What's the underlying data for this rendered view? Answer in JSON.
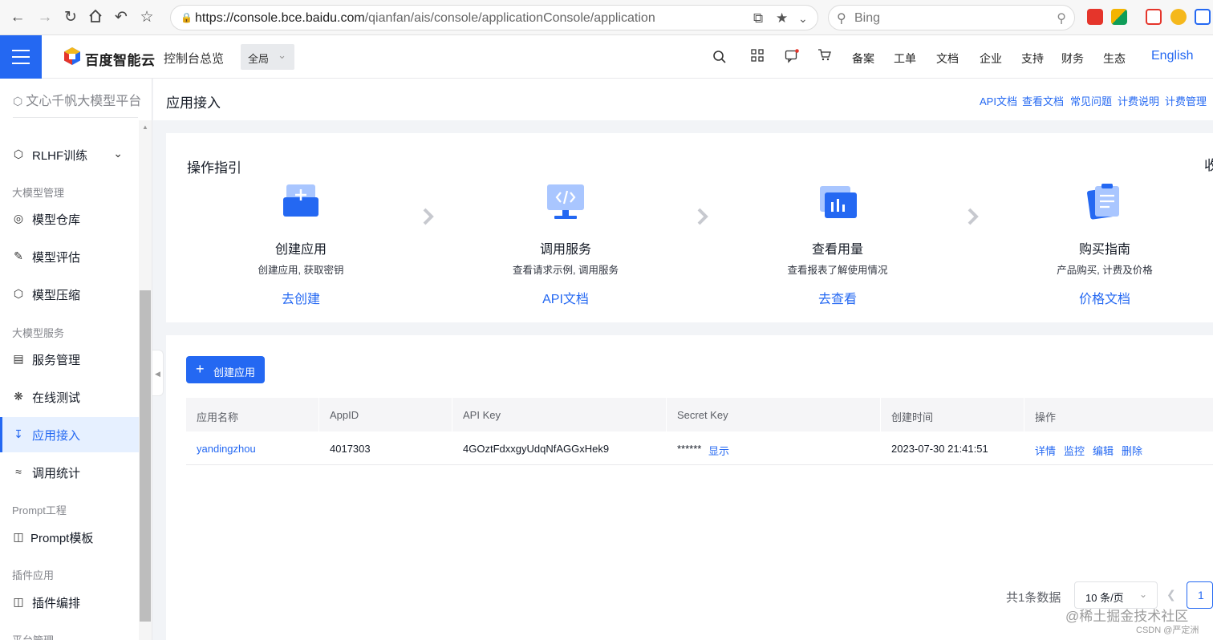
{
  "browser": {
    "url_host": "https://console.bce.baidu.com",
    "url_path": "/qianfan/ais/console/applicationConsole/application",
    "search_placeholder": "Bing"
  },
  "header": {
    "logo_text": "百度智能云",
    "console_home": "控制台总览",
    "region": "全局",
    "links": [
      "备案",
      "工单",
      "文档",
      "企业",
      "支持",
      "财务",
      "生态"
    ],
    "language": "English"
  },
  "sidebar": {
    "title": "文心千帆大模型平台",
    "items": [
      {
        "label": "RLHF训练"
      },
      {
        "label": "大模型管理"
      },
      {
        "label": "模型仓库"
      },
      {
        "label": "模型评估"
      },
      {
        "label": "模型压缩"
      },
      {
        "label": "大模型服务"
      },
      {
        "label": "服务管理"
      },
      {
        "label": "在线测试"
      },
      {
        "label": "应用接入"
      },
      {
        "label": "调用统计"
      },
      {
        "label": "Prompt工程"
      },
      {
        "label": "Prompt模板"
      },
      {
        "label": "插件应用"
      },
      {
        "label": "插件编排"
      },
      {
        "label": "平台管理"
      }
    ]
  },
  "page": {
    "title": "应用接入",
    "doc_links": [
      "API文档",
      "查看文档",
      "常见问题",
      "计费说明",
      "计费管理"
    ]
  },
  "guide": {
    "title": "操作指引",
    "collapse": "收",
    "steps": [
      {
        "title": "创建应用",
        "desc": "创建应用, 获取密钥",
        "link": "去创建"
      },
      {
        "title": "调用服务",
        "desc": "查看请求示例, 调用服务",
        "link": "API文档"
      },
      {
        "title": "查看用量",
        "desc": "查看报表了解使用情况",
        "link": "去查看"
      },
      {
        "title": "购买指南",
        "desc": "产品购买, 计费及价格",
        "link": "价格文档"
      }
    ]
  },
  "apps": {
    "create_button": "创建应用",
    "columns": [
      "应用名称",
      "AppID",
      "API Key",
      "Secret Key",
      "创建时间",
      "操作"
    ],
    "rows": [
      {
        "name": "yandingzhou",
        "app_id": "4017303",
        "api_key": "4GOztFdxxgyUdqNfAGGxHek9",
        "secret_masked": "******",
        "secret_show": "显示",
        "created": "2023-07-30 21:41:51",
        "actions": [
          "详情",
          "监控",
          "编辑",
          "删除"
        ]
      }
    ]
  },
  "pagination": {
    "total": "共1条数据",
    "page_size": "10 条/页",
    "current_page": "1"
  },
  "watermark": {
    "main": "@稀土掘金技术社区",
    "sub": "CSDN @严定洲"
  },
  "colors": {
    "accent": "#2468f2",
    "active_bg": "#e6f0ff"
  }
}
